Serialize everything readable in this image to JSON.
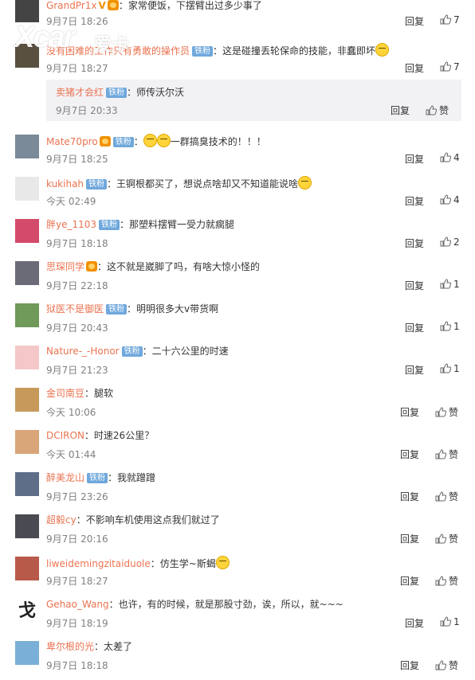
{
  "watermark": {
    "logo": "Xcar",
    "text": "爱卡"
  },
  "comments": [
    {
      "user": "GrandPr1x",
      "badge": "",
      "text": "：家常便饭，下摆臂出过多少事了",
      "time": "9月7日 18:26",
      "reply": "回复",
      "likes": "7"
    },
    {
      "user": "没有困难的工作只有勇敢的操作员",
      "badge": "铁粉",
      "text": "：这是碰撞丢轮保命的技能，非蠢即坏",
      "time": "9月7日 18:27",
      "reply": "回复",
      "likes": "7"
    },
    {
      "user": "Mate70pro",
      "badge": "铁粉",
      "text": "：",
      "text2": "一群搞臭技术的！！！",
      "time": "9月7日 18:25",
      "reply": "回复",
      "likes": "4"
    },
    {
      "user": "kukihah",
      "badge": "铁粉",
      "text": "：王锕根都买了，想说点啥却又不知道能说啥",
      "time": "今天 02:49",
      "reply": "回复",
      "likes": "4"
    },
    {
      "user": "胖ye_1103",
      "badge": "铁粉",
      "text": "：那塑料摆臂一受力就瘸腿",
      "time": "9月7日 18:18",
      "reply": "回复",
      "likes": "2"
    },
    {
      "user": "思琛同学",
      "badge": "",
      "text": "：这不就是崴脚了吗，有啥大惊小怪的",
      "time": "9月7日 22:18",
      "reply": "回复",
      "likes": "1"
    },
    {
      "user": "狱医不是御医",
      "badge": "铁粉",
      "text": "：明明很多大v带货啊",
      "time": "9月7日 20:43",
      "reply": "回复",
      "likes": "1"
    },
    {
      "user": "Nature-_-Honor",
      "badge": "铁粉",
      "text": "：二十六公里的时速",
      "time": "9月7日 21:23",
      "reply": "回复",
      "likes": "1"
    },
    {
      "user": "金司南豆",
      "badge": "",
      "text": "：腿软",
      "time": "今天 10:06",
      "reply": "回复",
      "likes": "赞"
    },
    {
      "user": "DCIRON",
      "badge": "",
      "text": "：时速26公里？",
      "time": "今天 01:44",
      "reply": "回复",
      "likes": "赞"
    },
    {
      "user": "醉美龙山",
      "badge": "铁粉",
      "text": "：我就蹭蹭",
      "time": "9月7日 23:26",
      "reply": "回复",
      "likes": "赞"
    },
    {
      "user": "超毅cy",
      "badge": "",
      "text": "：不影响车机使用这点我们就过了",
      "time": "9月7日 20:16",
      "reply": "回复",
      "likes": "赞"
    },
    {
      "user": "liweidemingzitaiduole",
      "badge": "",
      "text": "：仿生学~斯蝎",
      "time": "9月7日 18:27",
      "reply": "回复",
      "likes": "赞"
    },
    {
      "user": "Gehao_Wang",
      "badge": "",
      "text": "：也许，有的时候，就是那股寸劲，诶，所以，就~~~",
      "time": "9月7日 18:19",
      "reply": "回复",
      "likes": "1"
    },
    {
      "user": "卑尔根的光",
      "badge": "",
      "text": "：太差了",
      "time": "9月7日 18:18",
      "reply": "回复",
      "likes": "赞"
    }
  ],
  "subreply": {
    "user": "卖猪才会红",
    "badge": "铁粉",
    "text": "：师传沃尔沃",
    "time": "9月7日 20:33",
    "reply": "回复",
    "likes": "赞"
  },
  "avatar_char": "戈",
  "colors": {
    "username": "#eb7350",
    "badge": "#6fa8dc",
    "time": "#808080",
    "subreply_bg": "#f2f2f5"
  }
}
